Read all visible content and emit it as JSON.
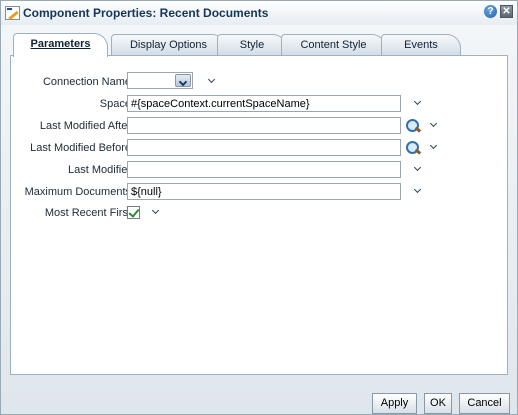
{
  "dialog": {
    "title": "Component Properties: Recent Documents",
    "help_symbol": "?",
    "close_symbol": "✕"
  },
  "tabs": [
    {
      "label": "Parameters",
      "active": true
    },
    {
      "label": "Display Options",
      "active": false
    },
    {
      "label": "Style",
      "active": false
    },
    {
      "label": "Content Style",
      "active": false
    },
    {
      "label": "Events",
      "active": false
    }
  ],
  "form": {
    "connection_name": {
      "label": "Connection Name",
      "value": ""
    },
    "space": {
      "label": "Space",
      "value": "#{spaceContext.currentSpaceName}"
    },
    "last_modified_after": {
      "label": "Last Modified After",
      "value": ""
    },
    "last_modified_before": {
      "label": "Last Modified Before",
      "value": ""
    },
    "last_modifier": {
      "label": "Last Modifier",
      "value": ""
    },
    "maximum_documents": {
      "label": "Maximum Documents",
      "value": "${null}"
    },
    "most_recent_first": {
      "label": "Most Recent First",
      "checked": true
    }
  },
  "footer": {
    "apply_label": "Apply",
    "ok_label": "OK",
    "cancel_label": "Cancel"
  }
}
